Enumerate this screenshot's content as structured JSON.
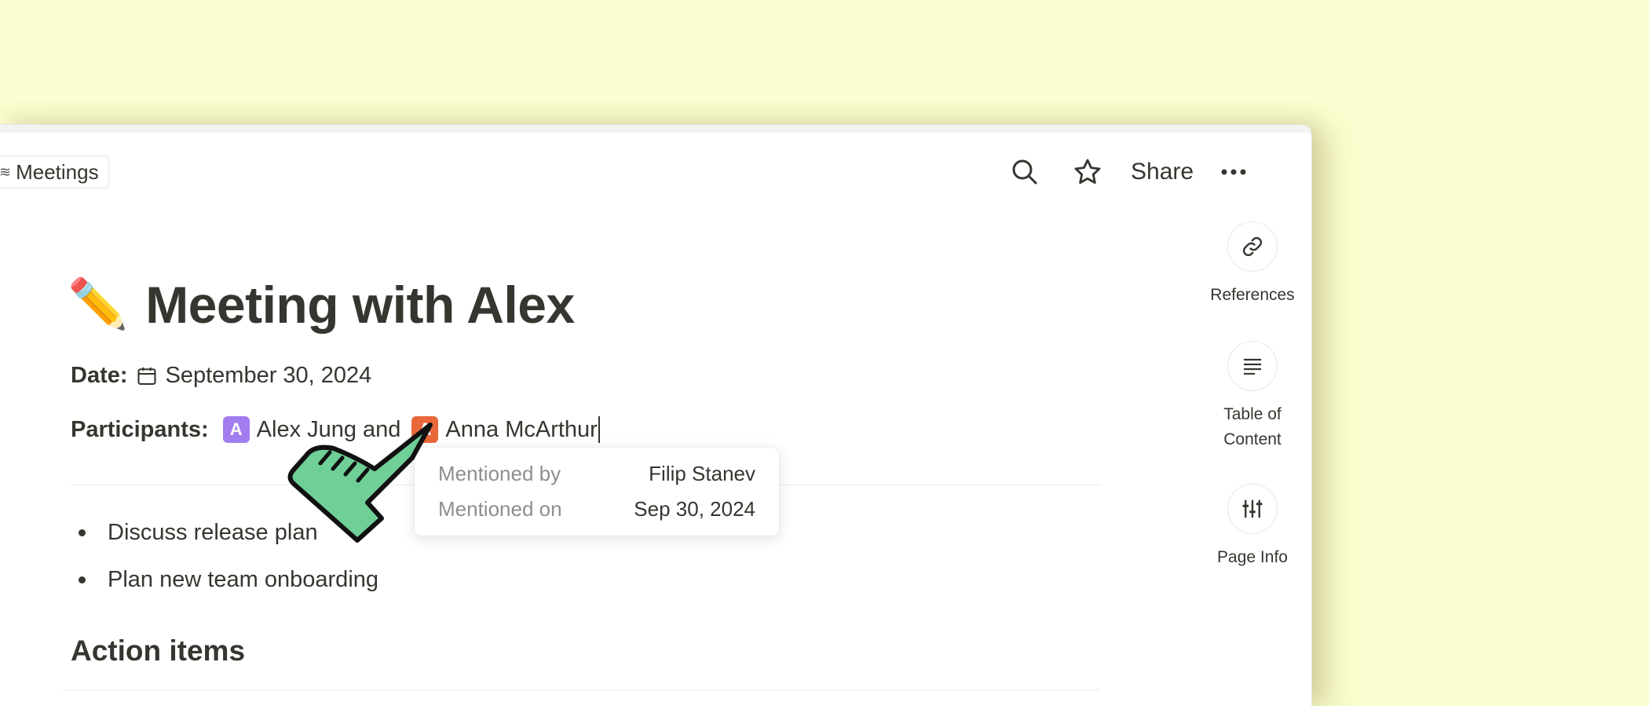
{
  "breadcrumb": {
    "label": "Meetings",
    "icon": "stack-icon"
  },
  "header": {
    "share_label": "Share"
  },
  "page": {
    "emoji": "✏️",
    "title": "Meeting with Alex",
    "date_label": "Date:",
    "date_value": "September 30, 2024",
    "participants_label": "Participants:",
    "participants": [
      {
        "initial": "A",
        "name": "Alex Jung",
        "color": "#a17df0"
      },
      {
        "initial": "A",
        "name": "Anna McArthur",
        "color": "#e9683a"
      }
    ],
    "participants_joiner": "and",
    "bullets": [
      "Discuss release plan",
      "Plan new team onboarding"
    ],
    "section_heading": "Action items"
  },
  "tooltip": {
    "mentioned_by_label": "Mentioned by",
    "mentioned_by_value": "Filip Stanev",
    "mentioned_on_label": "Mentioned on",
    "mentioned_on_value": "Sep 30, 2024"
  },
  "right_panel": {
    "items": [
      {
        "label": "References",
        "icon": "link-icon"
      },
      {
        "label": "Table of Content",
        "icon": "text-align-icon"
      },
      {
        "label": "Page Info",
        "icon": "sliders-icon"
      }
    ]
  },
  "colors": {
    "background": "#fcfdd0",
    "cursor_hand": "#6fcf97"
  }
}
